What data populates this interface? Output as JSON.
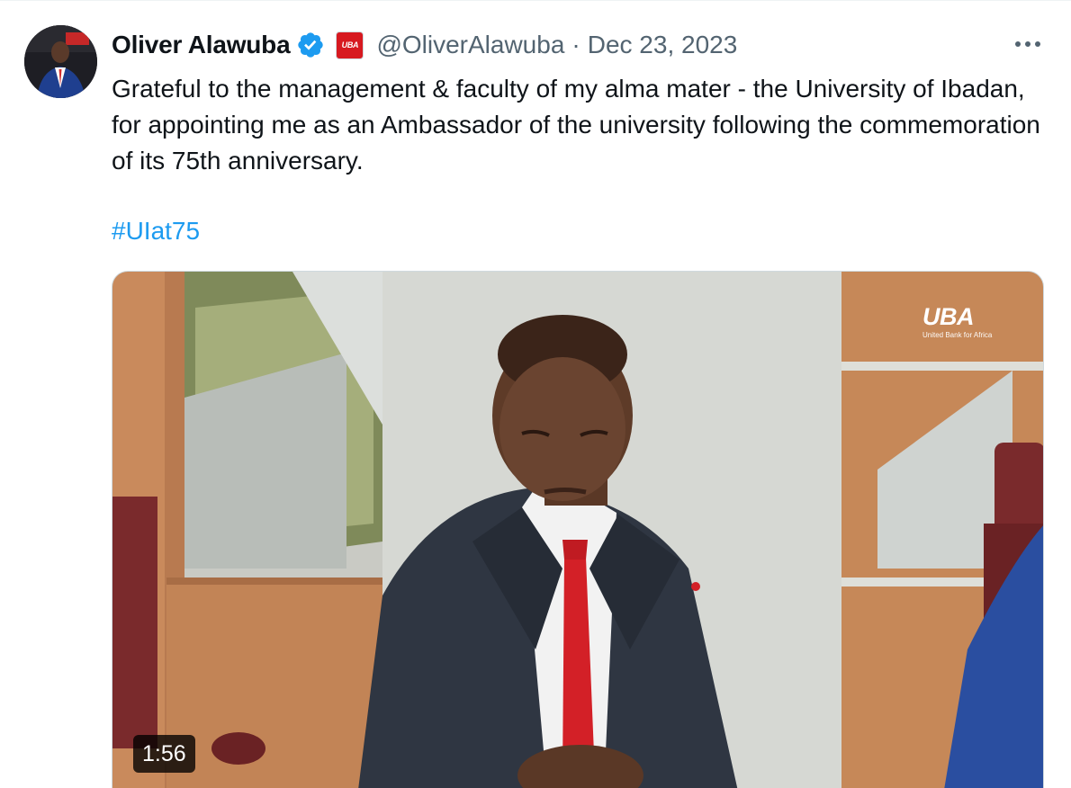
{
  "tweet": {
    "author_name": "Oliver Alawuba",
    "handle": "@OliverAlawuba",
    "separator": "·",
    "date": "Dec 23, 2023",
    "text": "Grateful to the management & faculty of my alma mater - the University of Ibadan, for appointing me as an Ambassador of the university following the commemoration of its 75th anniversary.",
    "hashtag": "#UIat75",
    "affiliate_badge_text": "UBA",
    "more_icon": "more-horizontal-icon",
    "verified_icon": "verified-badge-icon"
  },
  "media": {
    "type": "video",
    "duration": "1:56",
    "watermark_word": "UBA",
    "watermark_sub": "United Bank for Africa"
  },
  "colors": {
    "link": "#1d9bf0",
    "secondary_text": "#536471",
    "verified": "#1d9bf0",
    "uba_red": "#d71920"
  }
}
